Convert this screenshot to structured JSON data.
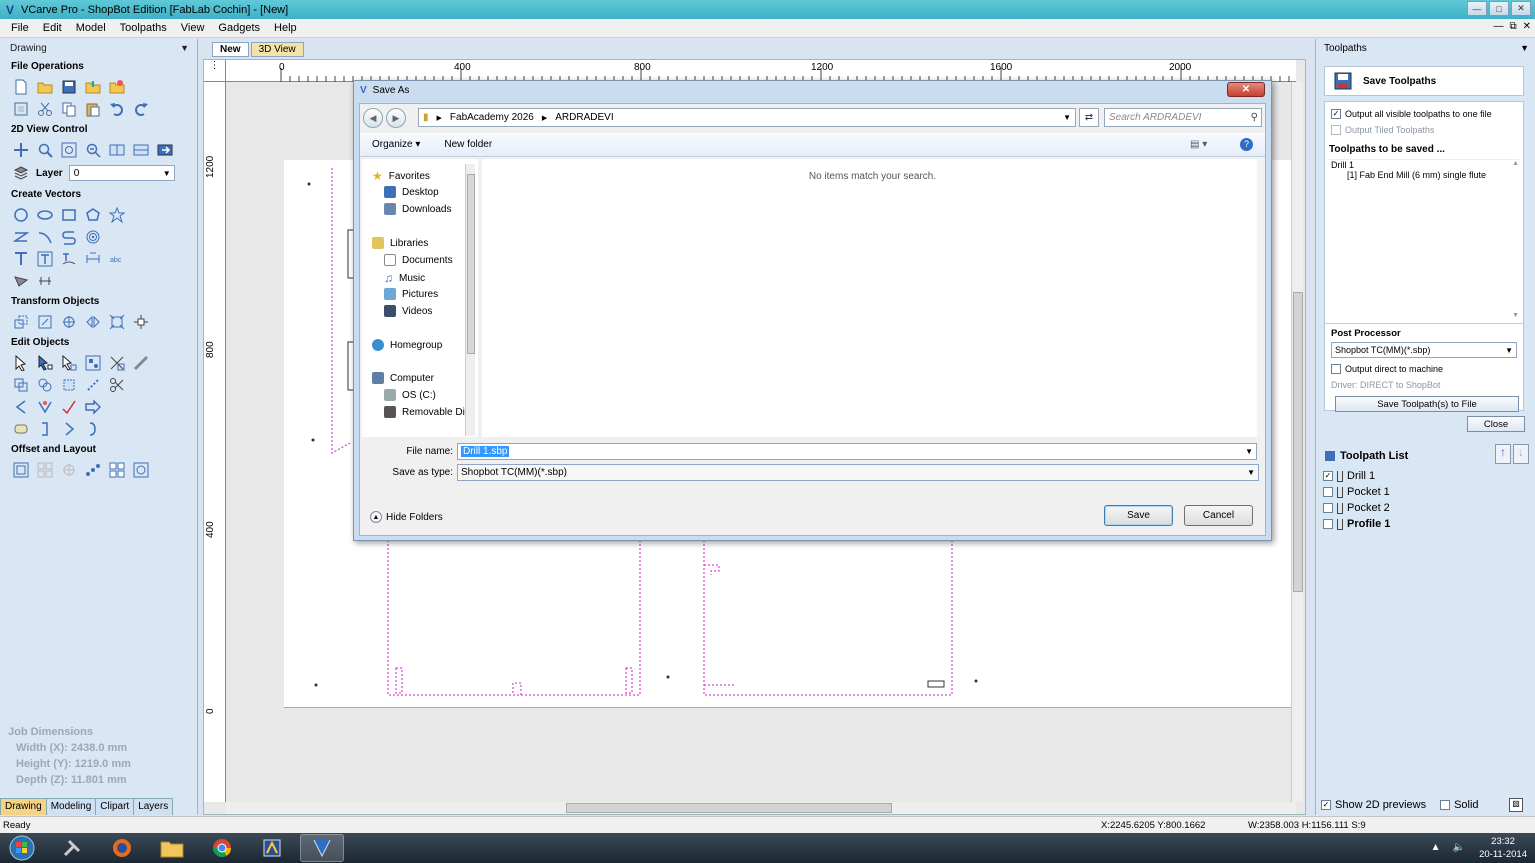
{
  "window": {
    "title": "VCarve Pro - ShopBot Edition [FabLab Cochin] - [New]"
  },
  "menu": [
    "File",
    "Edit",
    "Model",
    "Toolpaths",
    "View",
    "Gadgets",
    "Help"
  ],
  "left_panel": {
    "header": "Drawing",
    "sections": {
      "file_operations": "File Operations",
      "view_control": "2D View Control",
      "create_vectors": "Create Vectors",
      "transform_objects": "Transform Objects",
      "edit_objects": "Edit Objects",
      "offset_layout": "Offset and Layout"
    },
    "layer": {
      "label": "Layer",
      "value": "0"
    },
    "job_dimensions": {
      "title": "Job Dimensions",
      "width": "Width  (X): 2438.0 mm",
      "height": "Height (Y): 1219.0 mm",
      "depth": "Depth  (Z): 11.801 mm"
    },
    "tabs": [
      "Drawing",
      "Modeling",
      "Clipart",
      "Layers"
    ]
  },
  "doc_tabs": [
    "New",
    "3D View"
  ],
  "rulers": {
    "horizontal": [
      "0",
      "400",
      "800",
      "1200",
      "1600",
      "2000"
    ],
    "vertical": [
      "1200",
      "800",
      "400",
      "0"
    ]
  },
  "right_panel": {
    "header": "Toolpaths",
    "save_toolpaths_title": "Save Toolpaths",
    "output_all_visible": "Output all visible toolpaths to one file",
    "output_tiled": "Output Tiled Toolpaths",
    "to_be_saved_title": "Toolpaths to be saved ...",
    "to_be_saved": [
      "Drill 1",
      "[1] Fab End Mill (6 mm) single flute"
    ],
    "post_processor_title": "Post Processor",
    "post_processor_value": "Shopbot TC(MM)(*.sbp)",
    "output_direct": "Output direct to machine",
    "driver": "Driver: DIRECT to ShopBot",
    "save_button": "Save Toolpath(s) to File",
    "close_button": "Close",
    "toolpath_list_title": "Toolpath List",
    "toolpaths": [
      {
        "name": "Drill 1",
        "checked": true
      },
      {
        "name": "Pocket 1",
        "checked": false
      },
      {
        "name": "Pocket 2",
        "checked": false
      },
      {
        "name": "Profile 1",
        "checked": false
      }
    ],
    "show_2d_previews": "Show 2D previews",
    "solid": "Solid"
  },
  "dialog": {
    "title": "Save As",
    "path": [
      "FabAcademy 2026",
      "ARDRADEVI"
    ],
    "search_placeholder": "Search ARDRADEVI",
    "organize": "Organize",
    "new_folder": "New folder",
    "nav": {
      "favorites": "Favorites",
      "desktop": "Desktop",
      "downloads": "Downloads",
      "libraries": "Libraries",
      "documents": "Documents",
      "music": "Music",
      "pictures": "Pictures",
      "videos": "Videos",
      "homegroup": "Homegroup",
      "computer": "Computer",
      "os_c": "OS (C:)",
      "removable": "Removable Dis"
    },
    "empty_message": "No items match your search.",
    "file_name_label": "File name:",
    "file_name_value": "Drill 1.sbp",
    "save_type_label": "Save as type:",
    "save_type_value": "Shopbot TC(MM)(*.sbp)",
    "hide_folders": "Hide Folders",
    "save_button": "Save",
    "cancel_button": "Cancel"
  },
  "status_bar": {
    "status": "Ready",
    "coords": "X:2245.6205 Y:800.1662",
    "size": "W:2358.003   H:1156.111  S:9"
  },
  "taskbar": {
    "time": "23:32",
    "date": "20-11-2014"
  },
  "colors": {
    "titlebar": "#3fb0c4",
    "panel": "#d9e6f4",
    "selection": "#3399ff",
    "vector_dashes": "#d11cc8"
  }
}
